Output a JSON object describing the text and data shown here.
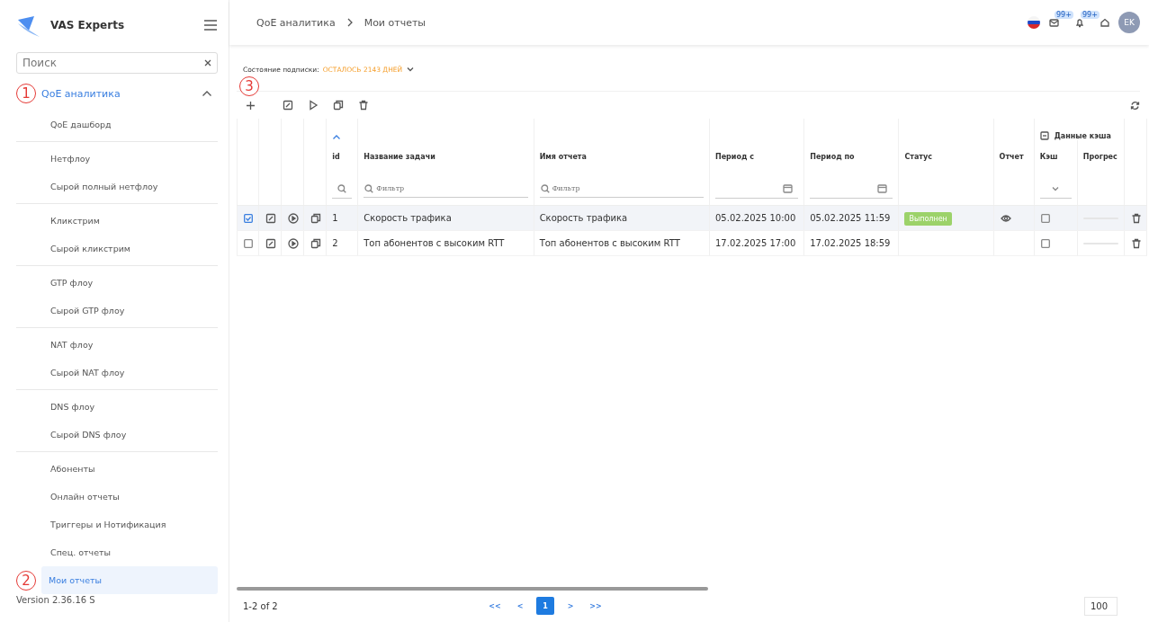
{
  "sidebar": {
    "brand": "VAS Experts",
    "search": {
      "placeholder": "Поиск"
    },
    "section": {
      "label": "QoE аналитика",
      "expanded": true,
      "marker": "1"
    },
    "groups": [
      {
        "items": [
          {
            "label": "QoE дашборд",
            "selected": false
          }
        ]
      },
      {
        "items": [
          {
            "label": "Нетфлоу",
            "selected": false
          },
          {
            "label": "Сырой полный нетфлоу",
            "selected": false
          }
        ]
      },
      {
        "items": [
          {
            "label": "Кликстрим",
            "selected": false
          },
          {
            "label": "Сырой кликстрим",
            "selected": false
          }
        ]
      },
      {
        "items": [
          {
            "label": "GTP флоу",
            "selected": false
          },
          {
            "label": "Сырой GTP флоу",
            "selected": false
          }
        ]
      },
      {
        "items": [
          {
            "label": "NAT флоу",
            "selected": false
          },
          {
            "label": "Сырой NAT флоу",
            "selected": false
          }
        ]
      },
      {
        "items": [
          {
            "label": "DNS флоу",
            "selected": false
          },
          {
            "label": "Сырой DNS флоу",
            "selected": false
          }
        ]
      },
      {
        "items": [
          {
            "label": "Абоненты",
            "selected": false
          },
          {
            "label": "Онлайн отчеты",
            "selected": false
          },
          {
            "label": "Триггеры и Нотификация",
            "selected": false
          },
          {
            "label": "Спец. отчеты",
            "selected": false
          },
          {
            "label": "Мои отчеты",
            "selected": true,
            "marker": "2"
          }
        ]
      }
    ],
    "version": "Version 2.36.16 S"
  },
  "header": {
    "breadcrumbs": [
      "QoE аналитика",
      "Мои отчеты"
    ],
    "mail_badge": "99+",
    "bell_badge": "99+",
    "avatar": "EK"
  },
  "subscription": {
    "label": "Состояние подписки:",
    "value": "ОСТАЛОСЬ 2143 ДНЕЙ"
  },
  "toolbar": {
    "marker": "3"
  },
  "table": {
    "group_header": "Данные кэша",
    "columns": [
      {
        "kind": "select"
      },
      {
        "kind": "edit"
      },
      {
        "kind": "run"
      },
      {
        "kind": "copy"
      },
      {
        "kind": "id",
        "label": "id",
        "sorted": true
      },
      {
        "kind": "text",
        "label": "Название задачи",
        "placeholder": "Фильтр"
      },
      {
        "kind": "text",
        "label": "Имя отчета",
        "placeholder": "Фильтр"
      },
      {
        "kind": "date",
        "label": "Период с"
      },
      {
        "kind": "date",
        "label": "Период по"
      },
      {
        "kind": "status",
        "label": "Статус"
      },
      {
        "kind": "report",
        "label": "Отчет"
      },
      {
        "kind": "cache",
        "label": "Кэш"
      },
      {
        "kind": "progress",
        "label": "Прогрес"
      },
      {
        "kind": "delete"
      }
    ],
    "rows": [
      {
        "selected": true,
        "id": "1",
        "task": "Скорость трафика",
        "report": "Скорость трафика",
        "from": "05.02.2025 10:00",
        "to": "05.02.2025 11:59",
        "status": "Выполнен",
        "has_report": true,
        "cached": false
      },
      {
        "selected": false,
        "id": "2",
        "task": "Топ абонентов с высоким RTT",
        "report": "Топ абонентов с высоким RTT",
        "from": "17.02.2025 17:00",
        "to": "17.02.2025 18:59",
        "has_report": false,
        "cached": false
      }
    ]
  },
  "footer": {
    "range": "1-2 of 2",
    "pages": [
      {
        "label": "<<",
        "kind": "nav"
      },
      {
        "label": "<",
        "kind": "nav"
      },
      {
        "label": "1",
        "kind": "page",
        "selected": true
      },
      {
        "label": ">",
        "kind": "nav"
      },
      {
        "label": ">>",
        "kind": "nav"
      }
    ],
    "page_size": "100"
  }
}
